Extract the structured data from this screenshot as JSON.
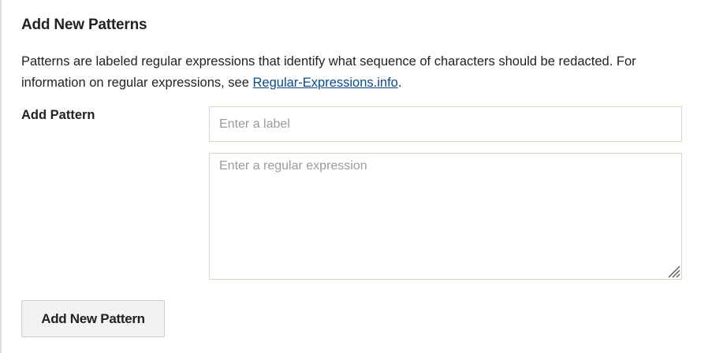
{
  "section": {
    "title": "Add New Patterns",
    "description_text": "Patterns are labeled regular expressions that identify what sequence of characters should be redacted. For information on regular expressions, see ",
    "description_link": "Regular-Expressions.info",
    "description_end": "."
  },
  "form": {
    "field_label": "Add Pattern",
    "label_input": {
      "value": "",
      "placeholder": "Enter a label"
    },
    "regex_input": {
      "value": "",
      "placeholder": "Enter a regular expression"
    },
    "submit_label": "Add New Pattern"
  },
  "colors": {
    "link": "#0b4a8b",
    "input_border": "#d8d8c4",
    "button_background": "#f2f2f2"
  },
  "icons": {
    "resize_handle": "resize-grip-icon"
  }
}
